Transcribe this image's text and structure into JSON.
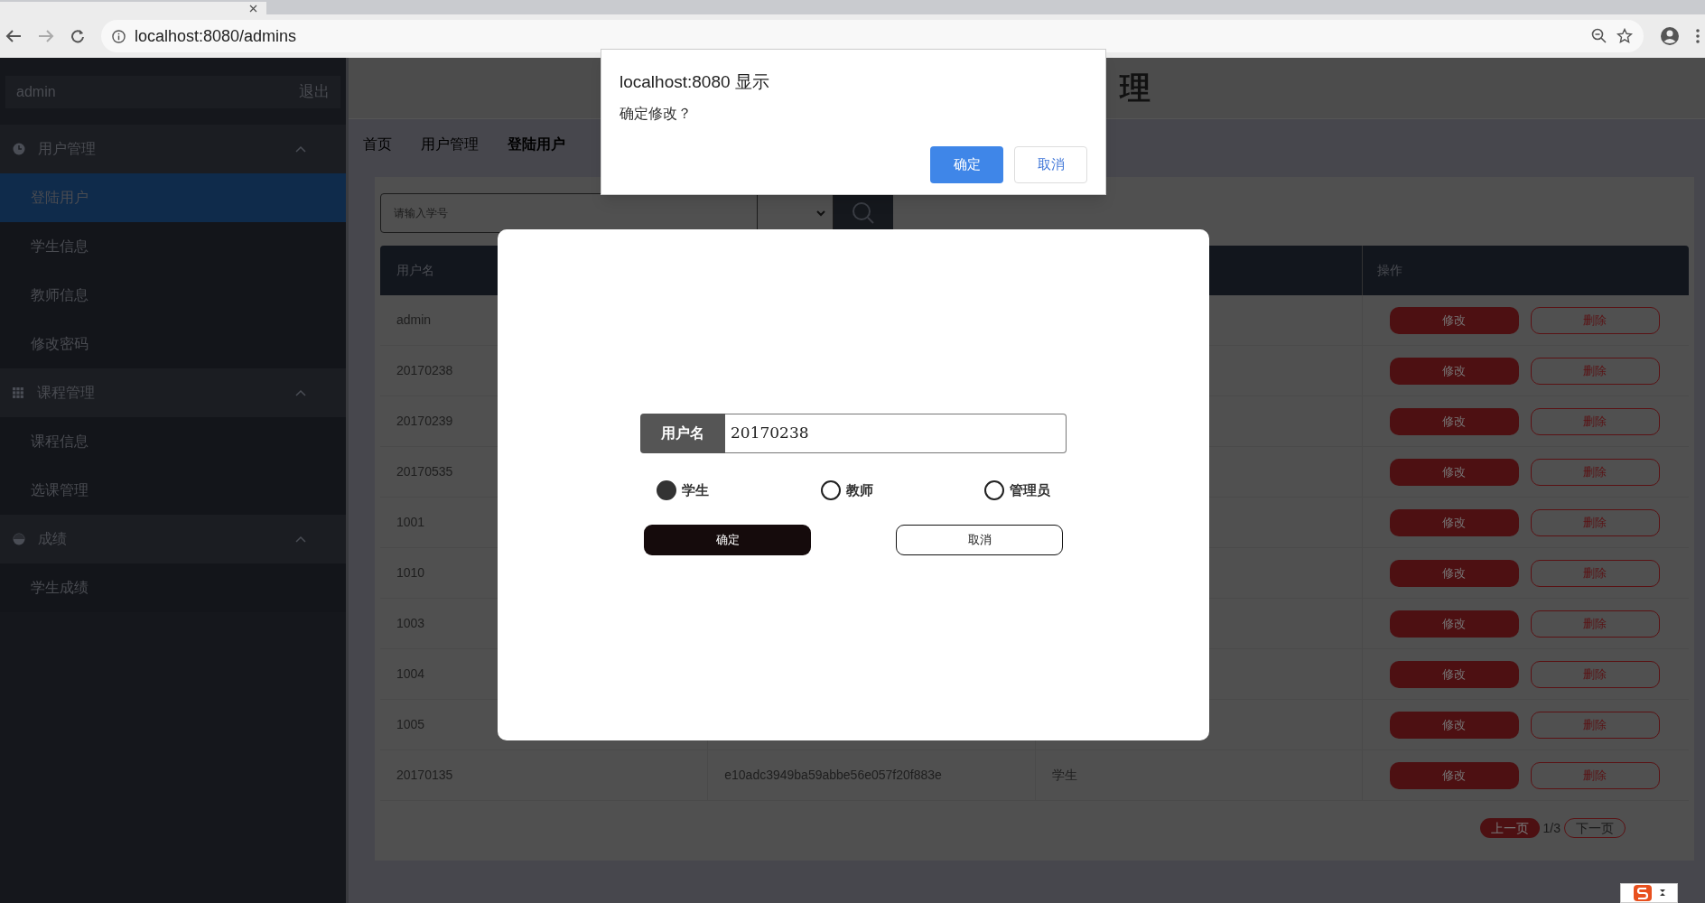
{
  "browser": {
    "url": "localhost:8080/admins"
  },
  "sidebar": {
    "user": "admin",
    "logout": "退出",
    "sections": [
      {
        "title": "用户管理",
        "expanded": true,
        "items": [
          {
            "label": "登陆用户",
            "selected": true
          },
          {
            "label": "学生信息",
            "selected": false
          },
          {
            "label": "教师信息",
            "selected": false
          },
          {
            "label": "修改密码",
            "selected": false
          }
        ]
      },
      {
        "title": "课程管理",
        "expanded": true,
        "items": [
          {
            "label": "课程信息",
            "selected": false
          },
          {
            "label": "选课管理",
            "selected": false
          }
        ]
      },
      {
        "title": "成绩",
        "expanded": true,
        "items": [
          {
            "label": "学生成绩",
            "selected": false
          }
        ]
      }
    ]
  },
  "header": {
    "title": "理"
  },
  "breadcrumb": [
    {
      "label": "首页",
      "current": false
    },
    {
      "label": "用户管理",
      "current": false
    },
    {
      "label": "登陆用户",
      "current": true
    }
  ],
  "search": {
    "placeholder": "请输入学号"
  },
  "table": {
    "header": {
      "username": "用户名",
      "actions": "操作"
    },
    "rows": [
      {
        "username": "admin",
        "edit": "修改",
        "delete": "删除"
      },
      {
        "username": "20170238",
        "edit": "修改",
        "delete": "删除"
      },
      {
        "username": "20170239",
        "edit": "修改",
        "delete": "删除"
      },
      {
        "username": "20170535",
        "edit": "修改",
        "delete": "删除"
      },
      {
        "username": "1001",
        "edit": "修改",
        "delete": "删除"
      },
      {
        "username": "1010",
        "edit": "修改",
        "delete": "删除"
      },
      {
        "username": "1003",
        "edit": "修改",
        "delete": "删除"
      },
      {
        "username": "1004",
        "edit": "修改",
        "delete": "删除"
      },
      {
        "username": "1005",
        "edit": "修改",
        "delete": "删除"
      },
      {
        "username": "20170135",
        "password": "e10adc3949ba59abbe56e057f20f883e",
        "role": "学生",
        "edit": "修改",
        "delete": "删除"
      }
    ]
  },
  "pagination": {
    "prev": "上一页",
    "page": "1/3",
    "next": "下一页"
  },
  "modal": {
    "field_label": "用户名",
    "value": "20170238",
    "roles": [
      {
        "label": "学生",
        "selected": true
      },
      {
        "label": "教师",
        "selected": false
      },
      {
        "label": "管理员",
        "selected": false
      }
    ],
    "confirm": "确定",
    "cancel": "取消"
  },
  "alert": {
    "title": "localhost:8080 显示",
    "message": "确定修改？",
    "ok": "确定",
    "cancel": "取消"
  }
}
